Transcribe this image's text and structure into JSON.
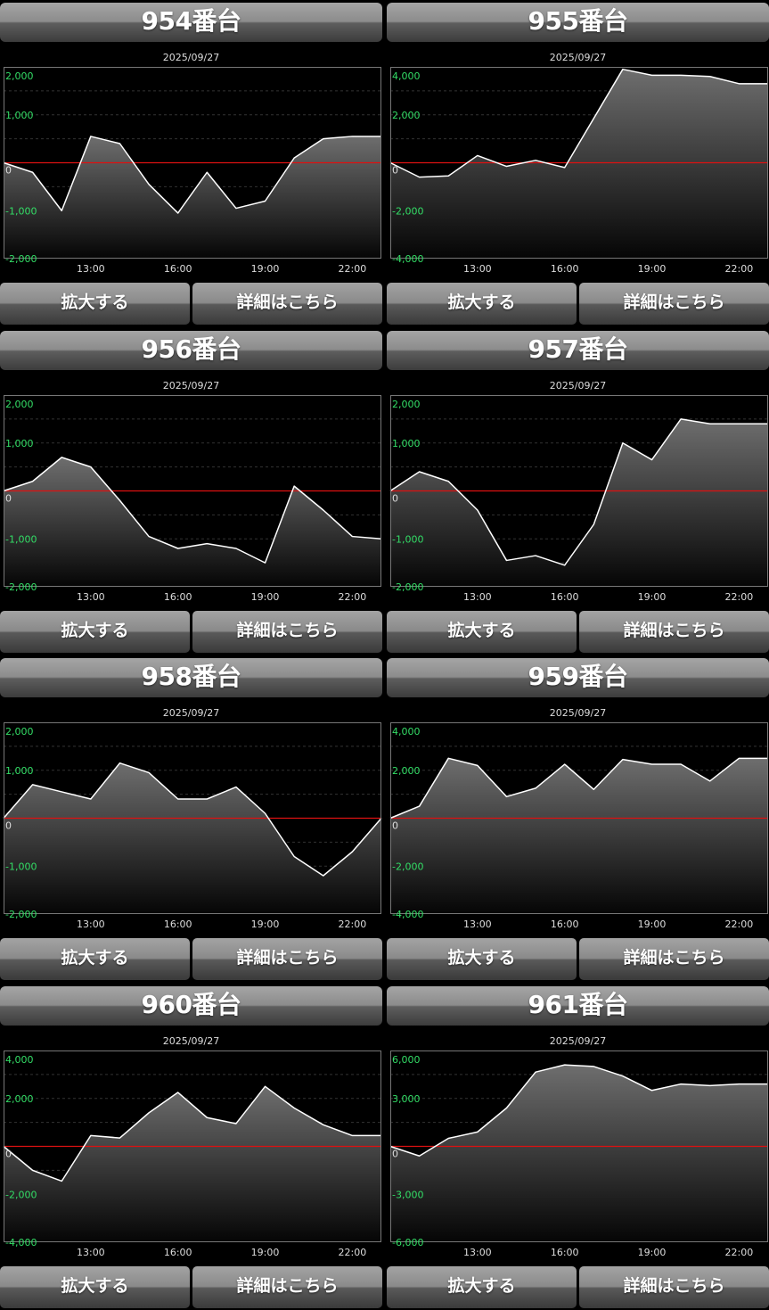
{
  "buttons": {
    "zoom_label": "拡大する",
    "detail_label": "詳細はこちら"
  },
  "colors": {
    "tick_label": "#33dd66",
    "zero_line": "#dd1111",
    "line": "#ffffff"
  },
  "x_ticks": [
    "13:00",
    "16:00",
    "19:00",
    "22:00"
  ],
  "chart_data": [
    {
      "type": "area",
      "title": "954番台",
      "date": "2025/09/27",
      "x": [
        10,
        11,
        12,
        13,
        14,
        15,
        16,
        17,
        18,
        19,
        20,
        21,
        22,
        23
      ],
      "values": [
        0,
        -200,
        -1000,
        550,
        400,
        -450,
        -1050,
        -200,
        -950,
        -800,
        100,
        500,
        550,
        550
      ],
      "yticks": [
        {
          "v": 2000,
          "label": "2,000"
        },
        {
          "v": 1000,
          "label": "1,000"
        },
        {
          "v": 0,
          "label": "0"
        },
        {
          "v": -1000,
          "label": "-1,000"
        },
        {
          "v": -2000,
          "label": "-2,000"
        }
      ],
      "ylim": [
        -2000,
        2000
      ]
    },
    {
      "type": "area",
      "title": "955番台",
      "date": "2025/09/27",
      "x": [
        10,
        11,
        12,
        13,
        14,
        15,
        16,
        17,
        18,
        19,
        20,
        21,
        22,
        23
      ],
      "values": [
        0,
        -600,
        -550,
        300,
        -150,
        100,
        -200,
        1850,
        3900,
        3650,
        3650,
        3600,
        3300,
        3300
      ],
      "yticks": [
        {
          "v": 4000,
          "label": "4,000"
        },
        {
          "v": 2000,
          "label": "2,000"
        },
        {
          "v": 0,
          "label": "0"
        },
        {
          "v": -2000,
          "label": "-2,000"
        },
        {
          "v": -4000,
          "label": "-4,000"
        }
      ],
      "ylim": [
        -4000,
        4000
      ]
    },
    {
      "type": "area",
      "title": "956番台",
      "date": "2025/09/27",
      "x": [
        10,
        11,
        12,
        13,
        14,
        15,
        16,
        17,
        18,
        19,
        20,
        21,
        22,
        23
      ],
      "values": [
        0,
        200,
        700,
        500,
        -200,
        -950,
        -1200,
        -1100,
        -1200,
        -1500,
        100,
        -400,
        -950,
        -1000
      ],
      "yticks": [
        {
          "v": 2000,
          "label": "2,000"
        },
        {
          "v": 1000,
          "label": "1,000"
        },
        {
          "v": 0,
          "label": "0"
        },
        {
          "v": -1000,
          "label": "-1,000"
        },
        {
          "v": -2000,
          "label": "-2,000"
        }
      ],
      "ylim": [
        -2000,
        2000
      ]
    },
    {
      "type": "area",
      "title": "957番台",
      "date": "2025/09/27",
      "x": [
        10,
        11,
        12,
        13,
        14,
        15,
        16,
        17,
        18,
        19,
        20,
        21,
        22,
        23
      ],
      "values": [
        0,
        400,
        200,
        -400,
        -1450,
        -1350,
        -1550,
        -700,
        1000,
        650,
        1500,
        1400,
        1400,
        1400
      ],
      "yticks": [
        {
          "v": 2000,
          "label": "2,000"
        },
        {
          "v": 1000,
          "label": "1,000"
        },
        {
          "v": 0,
          "label": "0"
        },
        {
          "v": -1000,
          "label": "-1,000"
        },
        {
          "v": -2000,
          "label": "-2,000"
        }
      ],
      "ylim": [
        -2000,
        2000
      ]
    },
    {
      "type": "area",
      "title": "958番台",
      "date": "2025/09/27",
      "x": [
        10,
        11,
        12,
        13,
        14,
        15,
        16,
        17,
        18,
        19,
        20,
        21,
        22,
        23
      ],
      "values": [
        0,
        700,
        550,
        400,
        1150,
        950,
        400,
        400,
        650,
        100,
        -800,
        -1200,
        -700,
        0
      ],
      "yticks": [
        {
          "v": 2000,
          "label": "2,000"
        },
        {
          "v": 1000,
          "label": "1,000"
        },
        {
          "v": 0,
          "label": "0"
        },
        {
          "v": -1000,
          "label": "-1,000"
        },
        {
          "v": -2000,
          "label": "-2,000"
        }
      ],
      "ylim": [
        -2000,
        2000
      ]
    },
    {
      "type": "area",
      "title": "959番台",
      "date": "2025/09/27",
      "x": [
        10,
        11,
        12,
        13,
        14,
        15,
        16,
        17,
        18,
        19,
        20,
        21,
        22,
        23
      ],
      "values": [
        0,
        500,
        2500,
        2200,
        900,
        1250,
        2250,
        1200,
        2450,
        2250,
        2250,
        1550,
        2500,
        2500
      ],
      "yticks": [
        {
          "v": 4000,
          "label": "4,000"
        },
        {
          "v": 2000,
          "label": "2,000"
        },
        {
          "v": 0,
          "label": "0"
        },
        {
          "v": -2000,
          "label": "-2,000"
        },
        {
          "v": -4000,
          "label": "-4,000"
        }
      ],
      "ylim": [
        -4000,
        4000
      ]
    },
    {
      "type": "area",
      "title": "960番台",
      "date": "2025/09/27",
      "x": [
        10,
        11,
        12,
        13,
        14,
        15,
        16,
        17,
        18,
        19,
        20,
        21,
        22,
        23
      ],
      "values": [
        0,
        -1000,
        -1450,
        450,
        350,
        1400,
        2250,
        1200,
        950,
        2500,
        1600,
        900,
        450,
        450
      ],
      "yticks": [
        {
          "v": 4000,
          "label": "4,000"
        },
        {
          "v": 2000,
          "label": "2,000"
        },
        {
          "v": 0,
          "label": "0"
        },
        {
          "v": -2000,
          "label": "-2,000"
        },
        {
          "v": -4000,
          "label": "-4,000"
        }
      ],
      "ylim": [
        -4000,
        4000
      ]
    },
    {
      "type": "area",
      "title": "961番台",
      "date": "2025/09/27",
      "x": [
        10,
        11,
        12,
        13,
        14,
        15,
        16,
        17,
        18,
        19,
        20,
        21,
        22,
        23
      ],
      "values": [
        0,
        -600,
        500,
        900,
        2400,
        4650,
        5100,
        5000,
        4400,
        3500,
        3900,
        3800,
        3900,
        3900
      ],
      "yticks": [
        {
          "v": 6000,
          "label": "6,000"
        },
        {
          "v": 3000,
          "label": "3,000"
        },
        {
          "v": 0,
          "label": "0"
        },
        {
          "v": -3000,
          "label": "-3,000"
        },
        {
          "v": -6000,
          "label": "-6,000"
        }
      ],
      "ylim": [
        -6000,
        6000
      ]
    }
  ]
}
